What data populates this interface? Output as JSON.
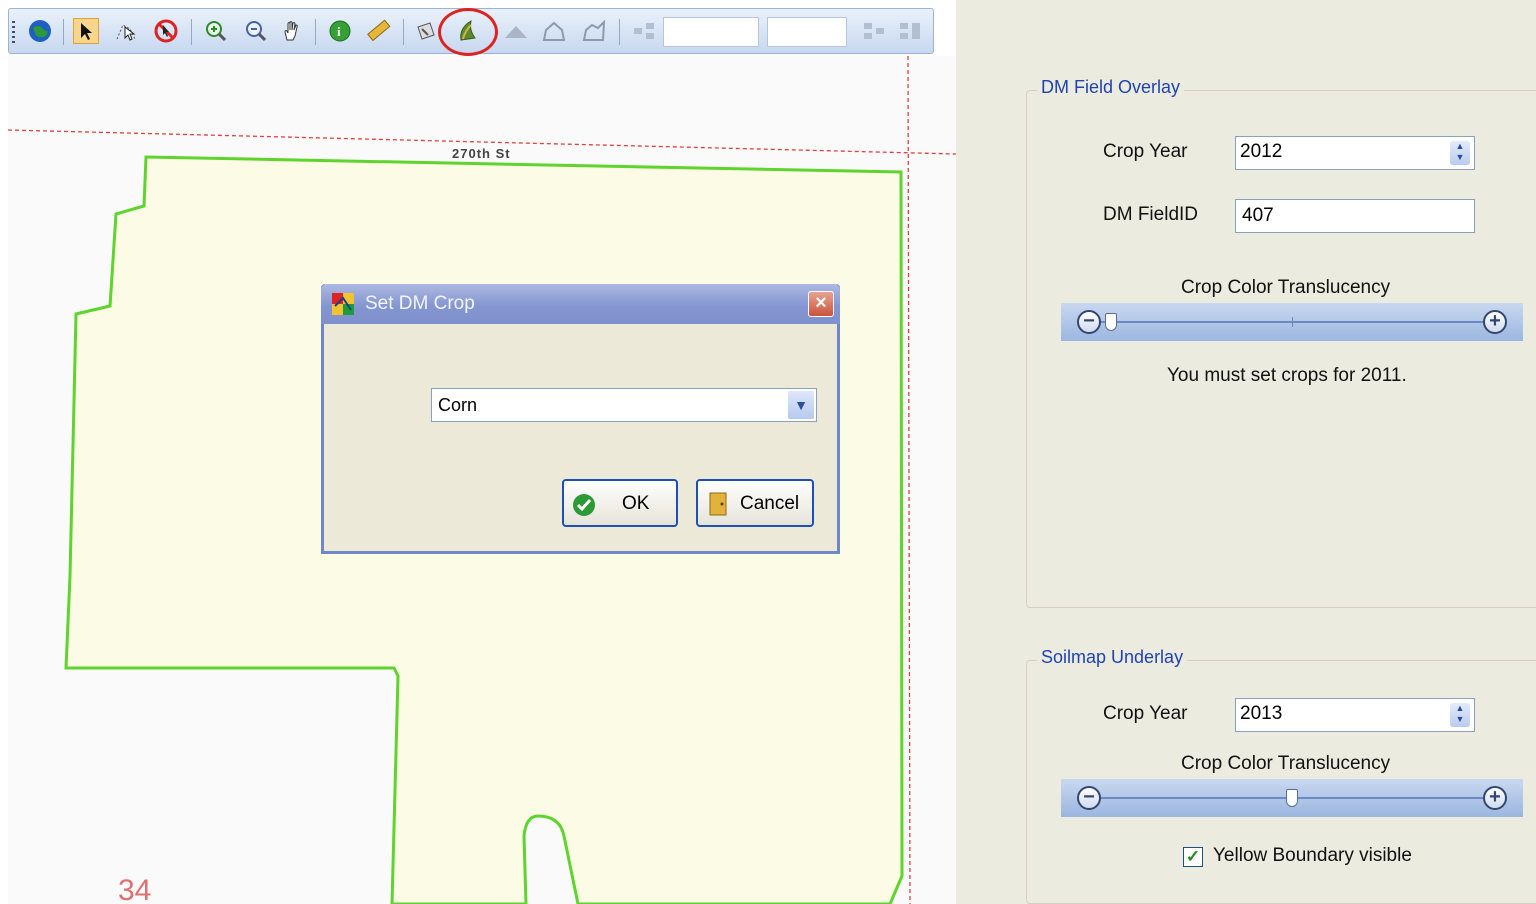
{
  "toolbar": {
    "icons": [
      "globe-icon",
      "select-arrow-icon",
      "select-feature-icon",
      "clear-selection-icon",
      "zoom-in-icon",
      "zoom-out-icon",
      "pan-hand-icon",
      "identify-icon",
      "measure-icon",
      "edit-tool-icon",
      "set-crop-icon",
      "polygon-fill-icon",
      "polygon-outline-icon",
      "polygon-edit-icon",
      "split-icon",
      "merge-icon",
      "merge-all-icon"
    ],
    "annotation_color": "#dd2222"
  },
  "map": {
    "road_label": "270th St",
    "section_number": "34",
    "field_boundary_color": "#5ed42d",
    "field_fill_color": "#fbfbe6"
  },
  "dialog": {
    "title": "Set DM Crop",
    "crop_value": "Corn",
    "ok_label": "OK",
    "cancel_label": "Cancel"
  },
  "dm_overlay": {
    "title": "DM Field Overlay",
    "crop_year_label": "Crop Year",
    "crop_year_value": "2012",
    "field_id_label": "DM FieldID",
    "field_id_value": "407",
    "translucency_label": "Crop Color Translucency",
    "translucency_level": 0.0,
    "message": "You must set crops for 2011."
  },
  "soilmap_underlay": {
    "title": "Soilmap Underlay",
    "crop_year_label": "Crop Year",
    "crop_year_value": "2013",
    "translucency_label": "Crop Color Translucency",
    "translucency_level": 0.5,
    "boundary_label": "Yellow Boundary visible",
    "boundary_checked": true
  }
}
